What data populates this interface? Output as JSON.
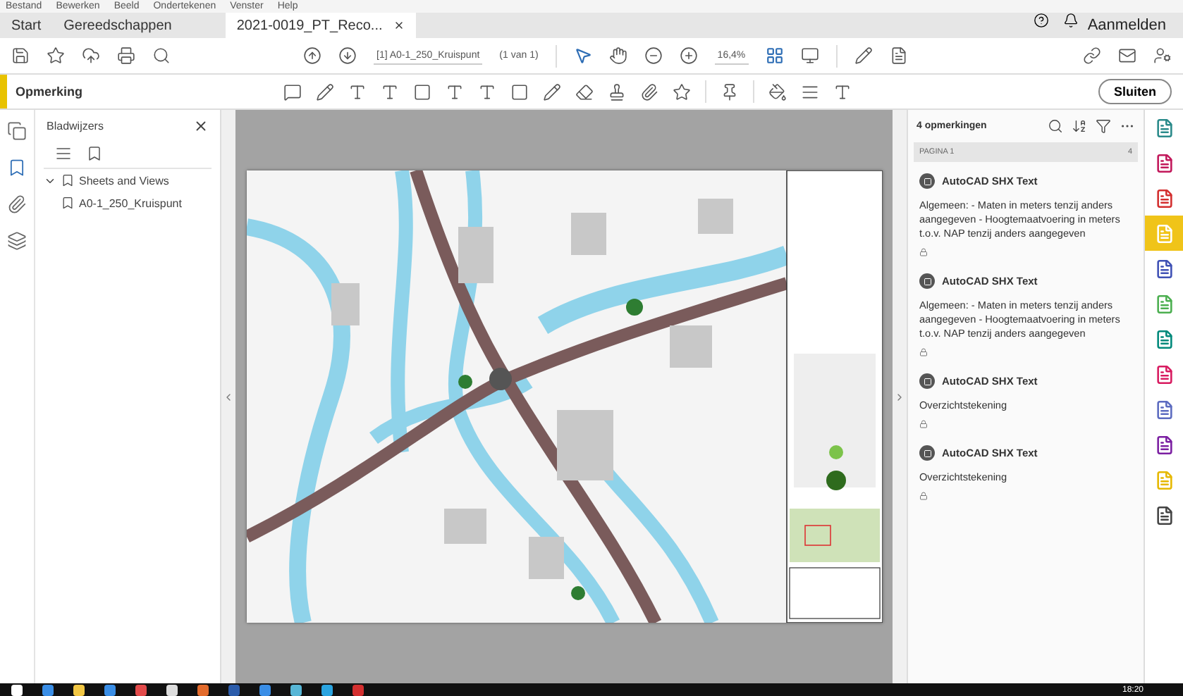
{
  "menu": [
    "Bestand",
    "Bewerken",
    "Beeld",
    "Ondertekenen",
    "Venster",
    "Help"
  ],
  "tabs": [
    {
      "label": "Start",
      "selected": false
    },
    {
      "label": "Gereedschappen",
      "selected": false
    },
    {
      "label": "2021-0019_PT_Reco...",
      "selected": true,
      "closable": true
    }
  ],
  "account": {
    "label": "Aanmelden"
  },
  "toolbar": {
    "page_field": "[1] A0-1_250_Kruispunt",
    "page_count": "(1 van 1)",
    "zoom": "16,4%"
  },
  "comment_toolbar": {
    "title": "Opmerking",
    "close_button": "Sluiten"
  },
  "bookmarks": {
    "title": "Bladwijzers",
    "tree": [
      {
        "label": "Sheets and Views",
        "expanded": true,
        "children": [
          {
            "label": "A0-1_250_Kruispunt"
          }
        ]
      }
    ]
  },
  "left_rail": [
    {
      "kind": "pages",
      "selected": false
    },
    {
      "kind": "bookmarks",
      "selected": true
    },
    {
      "kind": "attachments",
      "selected": false
    },
    {
      "kind": "layers",
      "selected": false
    }
  ],
  "comments": {
    "count": "4 opmerkingen",
    "page_header": "PAGINA 1",
    "page_count": "4",
    "items": [
      {
        "author": "AutoCAD SHX Text",
        "text": "Algemeen: - Maten in meters tenzij anders aangegeven - Hoogtemaatvoering in meters t.o.v. NAP tenzij anders aangegeven"
      },
      {
        "author": "AutoCAD SHX Text",
        "text": "Algemeen: - Maten in meters tenzij anders aangegeven - Hoogtemaatvoering in meters t.o.v. NAP tenzij anders aangegeven"
      },
      {
        "author": "AutoCAD SHX Text",
        "text": "Overzichtstekening"
      },
      {
        "author": "AutoCAD SHX Text",
        "text": "Overzichtstekening"
      }
    ]
  },
  "right_tools": [
    {
      "color": "#2a8a8a",
      "selected": false
    },
    {
      "color": "#c2185b",
      "selected": false
    },
    {
      "color": "#d32f2f",
      "selected": false
    },
    {
      "color": "#f0c419",
      "selected": true
    },
    {
      "color": "#3f51b5",
      "selected": false
    },
    {
      "color": "#4caf50",
      "selected": false
    },
    {
      "color": "#00897b",
      "selected": false
    },
    {
      "color": "#d81b60",
      "selected": false
    },
    {
      "color": "#5c6bc0",
      "selected": false
    },
    {
      "color": "#7b1fa2",
      "selected": false
    },
    {
      "color": "#e6b800",
      "selected": false
    },
    {
      "color": "#444444",
      "selected": false
    }
  ],
  "taskbar": {
    "time": "18:20"
  }
}
